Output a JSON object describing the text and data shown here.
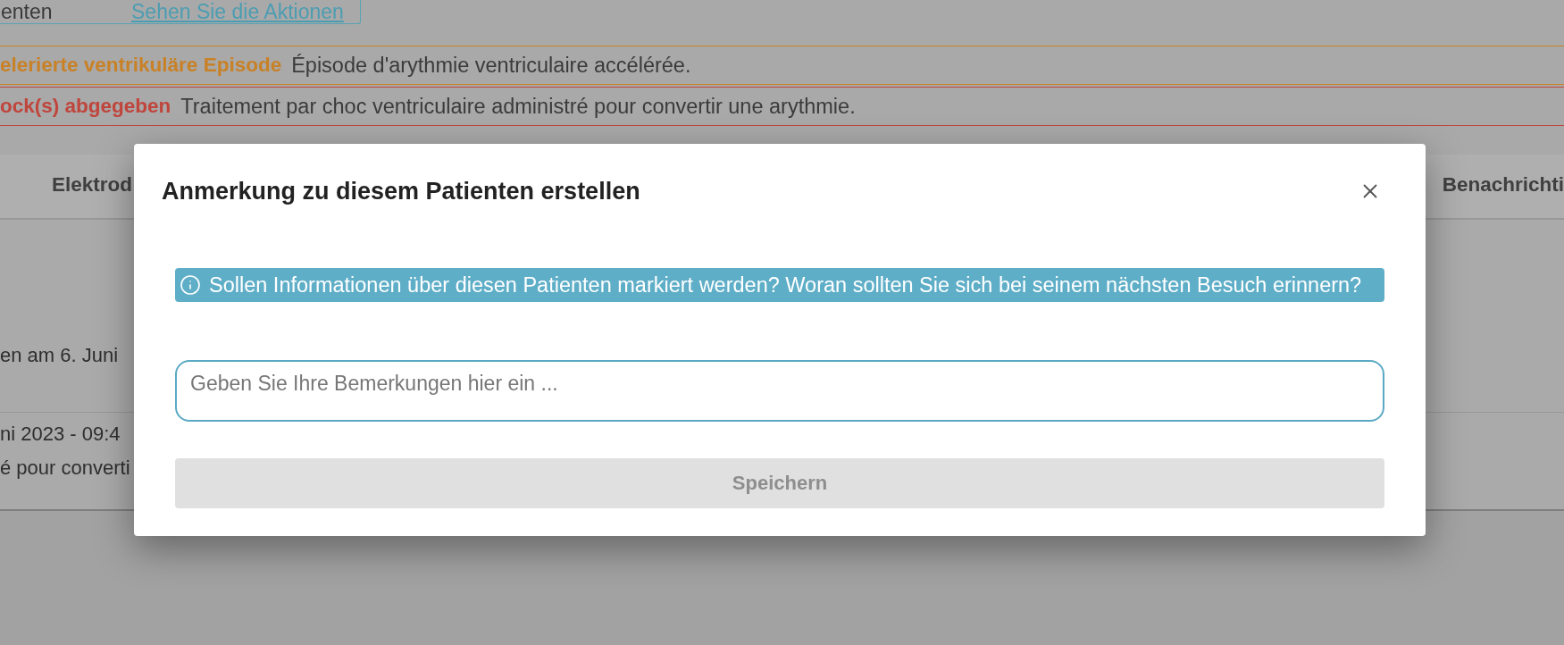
{
  "action_bar": {
    "label": "enten",
    "link": "Sehen Sie die Aktionen"
  },
  "alerts": [
    {
      "title": "elerierte ventrikuläre Episode",
      "description": "Épisode d'arythmie ventriculaire accélérée.",
      "color": "#c98126"
    },
    {
      "title": "ock(s) abgegeben",
      "description": "Traitement par choc ventriculaire administré pour convertir une arythmie.",
      "color": "#c0453c"
    }
  ],
  "tabs": [
    {
      "label": "Elektrod",
      "selected": false
    },
    {
      "label": "Benachrichti",
      "selected": false
    }
  ],
  "entries": [
    {
      "lines": [
        "en am 6. Juni"
      ]
    },
    {
      "lines": [
        "ni 2023 - 09:4",
        "é pour converti"
      ]
    }
  ],
  "dialog": {
    "title": "Anmerkung zu diesem Patienten erstellen",
    "info": "Sollen Informationen über diesen Patienten markiert werden? Woran sollten Sie sich bei seinem nächsten Besuch erinnern?",
    "note_field": {
      "placeholder": "Geben Sie Ihre Bemerkungen hier ein ...",
      "focused": true
    },
    "save_button": {
      "label": "Speichern",
      "disabled": true
    }
  }
}
